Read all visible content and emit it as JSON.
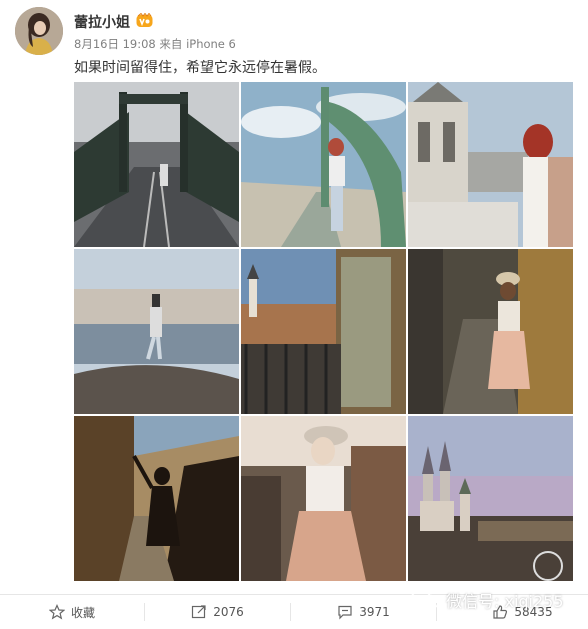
{
  "user": {
    "name": "蕾拉小姐",
    "date": "8月16日 19:08",
    "source_prefix": "来自",
    "source": "iPhone 6"
  },
  "post": {
    "text": "如果时间留得住，希望它永远停在暑假。"
  },
  "photos": [
    {
      "alt": "bridge-road-cyclist"
    },
    {
      "alt": "woman-on-bridge"
    },
    {
      "alt": "woman-by-castle-tower"
    },
    {
      "alt": "woman-on-riverbank"
    },
    {
      "alt": "city-view-through-window"
    },
    {
      "alt": "woman-in-alley"
    },
    {
      "alt": "silhouette-on-stairs"
    },
    {
      "alt": "woman-in-sunlight"
    },
    {
      "alt": "cathedral-spires-dusk"
    }
  ],
  "actions": {
    "favorite_label": "收藏",
    "repost_count": "2076",
    "comment_count": "3971",
    "like_count": "58435"
  },
  "watermark": {
    "text": "微信号: xiqi255"
  },
  "colors": {
    "text": "#333333",
    "meta": "#808080",
    "divider": "#e6e6e6",
    "vip": "#f7a61b"
  }
}
